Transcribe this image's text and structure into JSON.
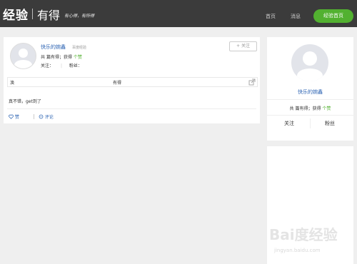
{
  "header": {
    "brand": "经验",
    "brand2": "有得",
    "slogan": "有心得，有所得",
    "nav_home": "首页",
    "nav_messages": "消息",
    "exp_home_button": "经验首页"
  },
  "post": {
    "username": "快乐的婉鑫",
    "level": "百度经验",
    "stats_prefix": "共",
    "stats_mid": "篇有得；获得",
    "stats_suffix": "个赞",
    "follow_label": "关注：",
    "fans_label": "粉丝：",
    "follow_button": "+ 关注",
    "row_label": "涣",
    "row_tag": "有得",
    "content": "真不错，get到了",
    "like": "赞",
    "comment": "评论"
  },
  "sidebar": {
    "username": "快乐的婉鑫",
    "stats_prefix": "共",
    "stats_mid": "篇有得；获得",
    "stats_suffix": "个赞",
    "follow_button": "关注",
    "fans_button": "粉丝"
  },
  "watermark": {
    "text": "Bai度经验",
    "url": "jingyan.baidu.com"
  },
  "colors": {
    "topbar": "#3b3b3b",
    "accent_green": "#52b130",
    "link_blue": "#2d64b3"
  }
}
